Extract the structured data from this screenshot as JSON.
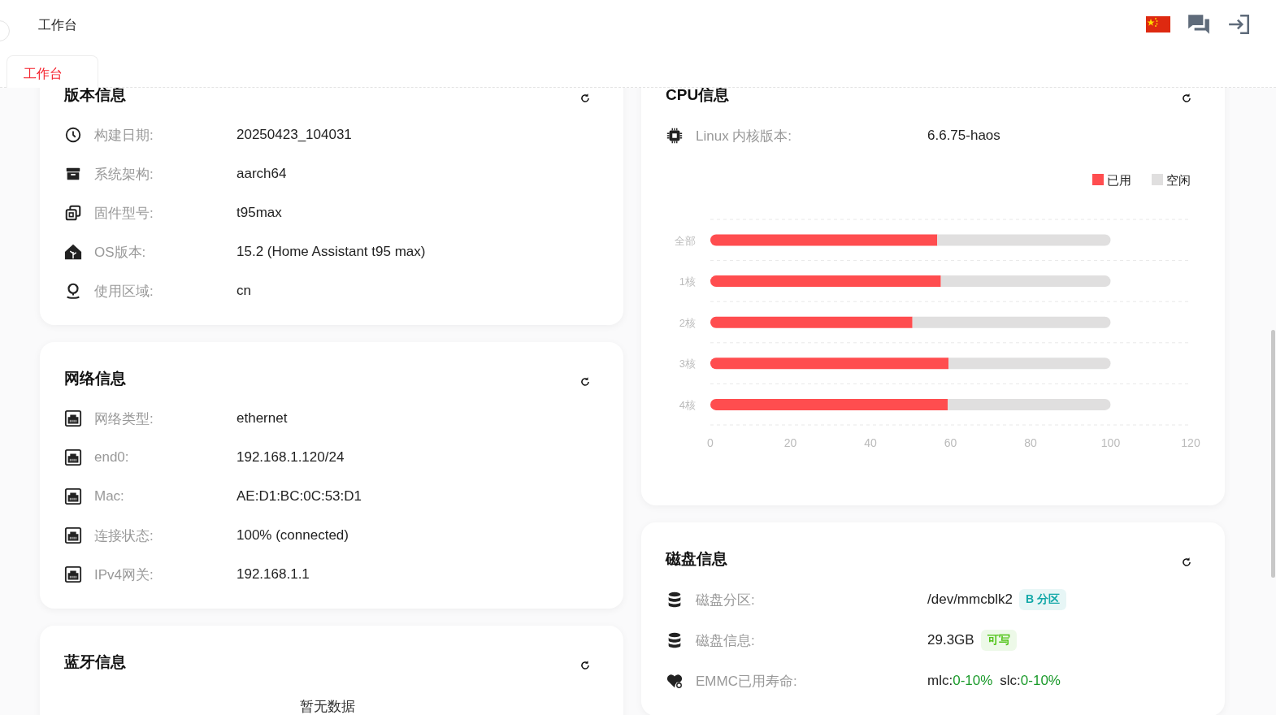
{
  "header": {
    "title": "工作台"
  },
  "tabs": [
    {
      "label": "工作台",
      "selected": true
    }
  ],
  "left_cards": [
    {
      "title": "版本信息",
      "rows": [
        {
          "kind": "text",
          "label": "构建日期:",
          "value": "20250423_104031"
        },
        {
          "kind": "text",
          "label": "系统架构:",
          "value": "aarch64"
        },
        {
          "kind": "text",
          "label": "固件型号:",
          "value": "t95max"
        },
        {
          "kind": "text",
          "label": "OS版本:",
          "value": "15.2 (Home Assistant t95 max)"
        },
        {
          "kind": "text",
          "label": "使用区域:",
          "value": "cn"
        }
      ]
    },
    {
      "title": "网络信息",
      "rows": [
        {
          "kind": "text",
          "label": "网络类型:",
          "value": "ethernet"
        },
        {
          "kind": "text",
          "label": "end0:",
          "value": "192.168.1.120/24"
        },
        {
          "kind": "text",
          "label": "Mac:",
          "value": "AE:D1:BC:0C:53:D1"
        },
        {
          "kind": "text",
          "label": "连接状态:",
          "value": "100% (connected)"
        },
        {
          "kind": "text",
          "label": "IPv4网关:",
          "value": "192.168.1.1"
        }
      ]
    },
    {
      "title": "蓝牙信息",
      "empty": "暂无数据"
    }
  ],
  "right_cards": [
    {
      "title": "CPU信息",
      "rows": [
        {
          "kind": "text",
          "label": "Linux 内核版本:",
          "value": "6.6.75-haos"
        }
      ],
      "chart_data": {
        "type": "bar",
        "orientation": "horizontal",
        "stacked": true,
        "categories": [
          "全部",
          "1核",
          "2核",
          "3核",
          "4核"
        ],
        "series": [
          {
            "name": "已用",
            "color": "#ff4d4f",
            "values": [
              56.7,
              57.6,
              50.5,
              59.5,
              59.3
            ]
          },
          {
            "name": "空闲",
            "color": "#e0dfdf",
            "values": [
              43.3,
              42.4,
              49.5,
              40.5,
              40.7
            ]
          }
        ],
        "xlim": [
          0,
          120
        ],
        "xticks": [
          0,
          20,
          40,
          60,
          80,
          100,
          120
        ],
        "legend": true
      }
    },
    {
      "title": "磁盘信息",
      "rows": [
        {
          "kind": "badge",
          "label": "磁盘分区:",
          "value": "/dev/mmcblk2",
          "badge": "B 分区",
          "color": "#13a8a8"
        },
        {
          "kind": "badge",
          "label": "磁盘信息:",
          "value": "29.3GB",
          "badge": "可写",
          "color": "#52c41a"
        },
        {
          "kind": "usage",
          "label": "EMMC已用寿命:",
          "parts": [
            {
              "text": "mlc:",
              "highlight": false
            },
            {
              "text": "0-10%",
              "highlight": true
            },
            {
              "text": "slc:",
              "highlight": false
            },
            {
              "text": "0-10%",
              "highlight": true
            }
          ]
        }
      ]
    }
  ]
}
